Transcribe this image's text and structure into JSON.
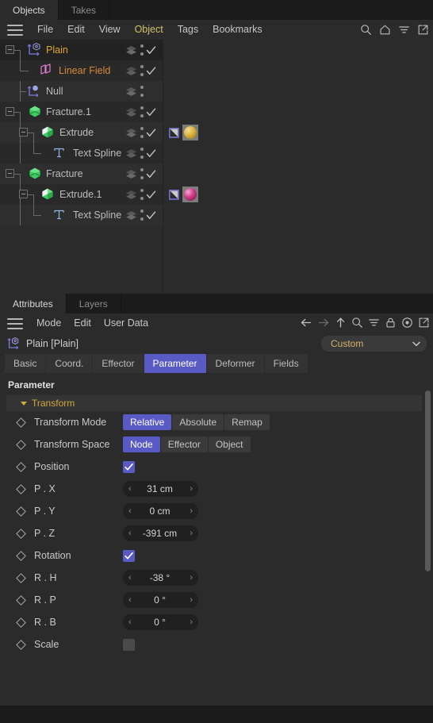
{
  "theme": {
    "accent": "#5a5ac4",
    "panel_bg": "#2b2b2b",
    "window_bg": "#1b1b1b",
    "menu_highlight": "#d2c06a",
    "group_header_text": "#d3a83f"
  },
  "object_manager": {
    "tabs": [
      {
        "label": "Objects",
        "active": true
      },
      {
        "label": "Takes",
        "active": false
      }
    ],
    "menu": [
      {
        "label": "File",
        "highlight": false
      },
      {
        "label": "Edit",
        "highlight": false
      },
      {
        "label": "View",
        "highlight": false
      },
      {
        "label": "Object",
        "highlight": true
      },
      {
        "label": "Tags",
        "highlight": false
      },
      {
        "label": "Bookmarks",
        "highlight": false
      }
    ],
    "toolbar_icons": [
      "search-icon",
      "home-icon",
      "filter-icon",
      "popout-icon"
    ],
    "objects": [
      {
        "name": "Plain",
        "type": "plain-effector",
        "depth": 0,
        "selected": true,
        "expander": true,
        "visible_tags": [
          "layer-tag",
          "dots-tag",
          "check-tag"
        ],
        "material": null
      },
      {
        "name": "Linear Field",
        "type": "linear-field",
        "depth": 1,
        "selected": false,
        "expander": false,
        "visible_tags": [
          "layer-tag",
          "dots-tag",
          "check-tag"
        ],
        "material": null
      },
      {
        "name": "Null",
        "type": "null-object",
        "depth": 0,
        "selected": false,
        "expander": false,
        "visible_tags": [
          "layer-tag",
          "dots-tag"
        ],
        "material": null
      },
      {
        "name": "Fracture.1",
        "type": "fracture",
        "depth": 0,
        "selected": false,
        "expander": true,
        "visible_tags": [
          "layer-tag",
          "dots-tag",
          "check-tag"
        ],
        "material": null
      },
      {
        "name": "Extrude",
        "type": "extrude",
        "depth": 1,
        "selected": false,
        "expander": true,
        "visible_tags": [
          "layer-tag",
          "dots-tag",
          "check-tag",
          "phong-tag"
        ],
        "material": "#d8b24a"
      },
      {
        "name": "Text Spline",
        "type": "text-spline",
        "depth": 2,
        "selected": false,
        "expander": false,
        "visible_tags": [
          "layer-tag",
          "dots-tag",
          "check-tag"
        ],
        "material": null
      },
      {
        "name": "Fracture",
        "type": "fracture",
        "depth": 0,
        "selected": false,
        "expander": true,
        "visible_tags": [
          "layer-tag",
          "dots-tag",
          "check-tag"
        ],
        "material": null
      },
      {
        "name": "Extrude.1",
        "type": "extrude",
        "depth": 1,
        "selected": false,
        "expander": true,
        "visible_tags": [
          "layer-tag",
          "dots-tag",
          "check-tag",
          "phong-tag"
        ],
        "material": "#cc3b86"
      },
      {
        "name": "Text Spline",
        "type": "text-spline",
        "depth": 2,
        "selected": false,
        "expander": false,
        "visible_tags": [
          "layer-tag",
          "dots-tag",
          "check-tag"
        ],
        "material": null
      }
    ]
  },
  "attribute_manager": {
    "tabs": [
      {
        "label": "Attributes",
        "active": true
      },
      {
        "label": "Layers",
        "active": false
      }
    ],
    "menu": [
      {
        "label": "Mode"
      },
      {
        "label": "Edit"
      },
      {
        "label": "User Data"
      }
    ],
    "toolbar_icons": [
      "back-arrow-icon",
      "forward-arrow-icon",
      "up-arrow-icon",
      "search-icon",
      "filter-icon",
      "lock-icon",
      "target-icon",
      "popout-icon"
    ],
    "object_title": "Plain [Plain]",
    "preset": {
      "label": "Custom"
    },
    "tabs_row": [
      {
        "label": "Basic",
        "active": false
      },
      {
        "label": "Coord.",
        "active": false
      },
      {
        "label": "Effector",
        "active": false
      },
      {
        "label": "Parameter",
        "active": true
      },
      {
        "label": "Deformer",
        "active": false
      },
      {
        "label": "Fields",
        "active": false
      }
    ],
    "section_title": "Parameter",
    "group": {
      "label": "Transform",
      "expanded": true
    },
    "parameters": [
      {
        "label": "Transform Mode",
        "control": "segmented",
        "options": [
          "Relative",
          "Absolute",
          "Remap"
        ],
        "value": "Relative"
      },
      {
        "label": "Transform Space",
        "control": "segmented",
        "options": [
          "Node",
          "Effector",
          "Object"
        ],
        "value": "Node"
      },
      {
        "label": "Position",
        "control": "checkbox",
        "value": true
      },
      {
        "label": "P . X",
        "control": "number",
        "value": "31 cm"
      },
      {
        "label": "P . Y",
        "control": "number",
        "value": "0 cm"
      },
      {
        "label": "P . Z",
        "control": "number",
        "value": "-391 cm"
      },
      {
        "label": "Rotation",
        "control": "checkbox",
        "value": true
      },
      {
        "label": "R . H",
        "control": "number",
        "value": "-38 °"
      },
      {
        "label": "R . P",
        "control": "number",
        "value": "0 °"
      },
      {
        "label": "R . B",
        "control": "number",
        "value": "0 °"
      },
      {
        "label": "Scale",
        "control": "checkbox",
        "value": false
      }
    ]
  }
}
